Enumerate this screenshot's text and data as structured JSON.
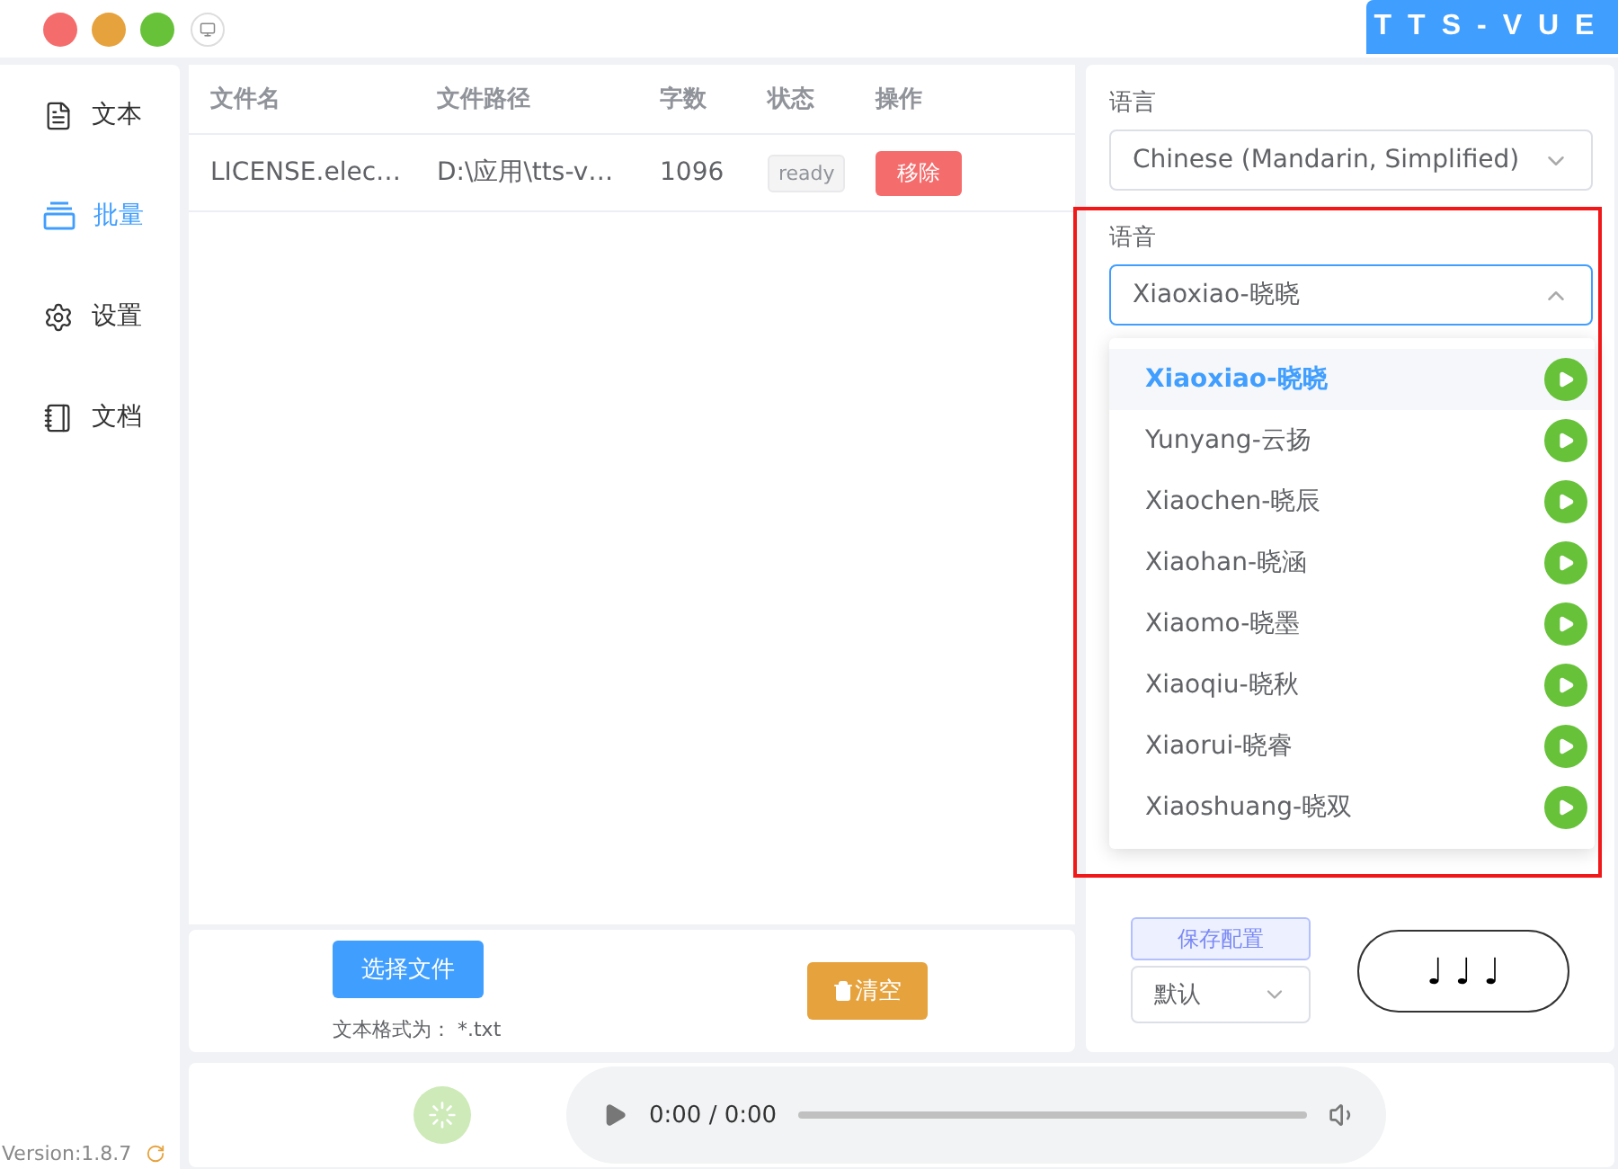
{
  "window": {
    "title": "TTS-VUE",
    "version": "Version:1.8.7"
  },
  "sidebar": {
    "items": [
      {
        "label": "文本",
        "selected": false
      },
      {
        "label": "批量",
        "selected": true
      },
      {
        "label": "设置",
        "selected": false
      },
      {
        "label": "文档",
        "selected": false
      }
    ]
  },
  "table": {
    "columns": [
      "文件名",
      "文件路径",
      "字数",
      "状态",
      "操作"
    ],
    "rows": [
      {
        "name": "LICENSE.elec…",
        "path": "D:\\应用\\tts-v…",
        "chars": "1096",
        "status": "ready",
        "action": "移除"
      }
    ]
  },
  "file_actions": {
    "select_button": "选择文件",
    "format_label": "文本格式为：",
    "format_value": "*.txt",
    "clear_button": "清空"
  },
  "settings": {
    "language_label": "语言",
    "language_value": "Chinese (Mandarin, Simplified)",
    "voice_label": "语音",
    "voice_value": "Xiaoxiao-晓晓",
    "voice_open": true,
    "highlighted": true,
    "voices": [
      {
        "name": "Xiaoxiao-晓晓",
        "selected": true
      },
      {
        "name": "Yunyang-云扬",
        "selected": false
      },
      {
        "name": "Xiaochen-晓辰",
        "selected": false
      },
      {
        "name": "Xiaohan-晓涵",
        "selected": false
      },
      {
        "name": "Xiaomo-晓墨",
        "selected": false
      },
      {
        "name": "Xiaoqiu-晓秋",
        "selected": false
      },
      {
        "name": "Xiaorui-晓睿",
        "selected": false
      },
      {
        "name": "Xiaoshuang-晓双",
        "selected": false
      }
    ],
    "save_button": "保存配置",
    "preset_value": "默认",
    "play_button": "♩ ♩ ♩"
  },
  "player": {
    "time": "0:00 / 0:00"
  }
}
